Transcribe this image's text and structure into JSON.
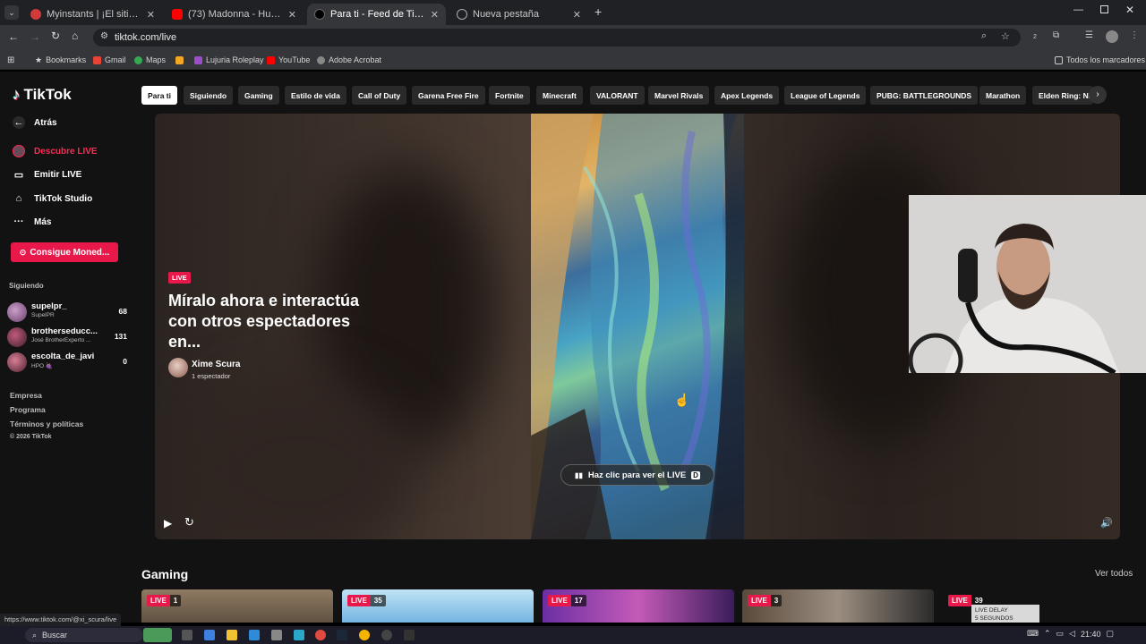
{
  "browser": {
    "tabs": [
      {
        "title": "Myinstants | ¡El sitio web de bo",
        "active": false,
        "color": "#d23b3b"
      },
      {
        "title": "(73) Madonna - Hung Up (Offici",
        "active": false,
        "color": "#ff0000"
      },
      {
        "title": "Para ti - Feed de TikTok LIVE",
        "active": true,
        "color": "#111111"
      },
      {
        "title": "Nueva pestaña",
        "active": false,
        "color": "#8a8a8a"
      }
    ],
    "url": "tiktok.com/live",
    "bookmarks": [
      "Bookmarks",
      "Gmail",
      "Maps",
      "",
      "Lujuria Roleplay",
      "YouTube",
      "Adobe Acrobat"
    ],
    "all_bookmarks": "Todos los marcadores",
    "extensions_badge": "2"
  },
  "sidebar": {
    "logo": "TikTok",
    "back": "Atrás",
    "nav": [
      "Descubre LIVE",
      "Emitir LIVE",
      "TikTok Studio",
      "Más"
    ],
    "coins_button": "Consigue Moned...",
    "following_title": "Siguiendo",
    "following": [
      {
        "name": "supelpr_",
        "sub": "SupelPR",
        "count": "68"
      },
      {
        "name": "brotherseducc...",
        "sub": "José BrotherExperto ...",
        "count": "131"
      },
      {
        "name": "escolta_de_javi",
        "sub": "HPO 🍇",
        "count": "0"
      }
    ],
    "footer": [
      "Empresa",
      "Programa",
      "Términos y políticas",
      "© 2026 TikTok"
    ]
  },
  "categories": [
    "Para ti",
    "Siguiendo",
    "Gaming",
    "Estilo de vida",
    "Call of Duty",
    "Garena Free Fire",
    "Fortnite",
    "Minecraft",
    "VALORANT",
    "Marvel Rivals",
    "Apex Legends",
    "League of Legends",
    "PUBG: BATTLEGROUNDS",
    "Marathon",
    "Elden Ring: Ni"
  ],
  "player": {
    "live_badge": "LIVE",
    "title": "Míralo ahora e interactúa con otros espectadores en...",
    "host_name": "Xime Scura",
    "viewers": "1 espectador",
    "cta": "Haz clic para ver el LIVE",
    "cta_key": "D"
  },
  "gaming": {
    "title": "Gaming",
    "see_all": "Ver todos",
    "cards": [
      {
        "live": "LIVE",
        "viewers": "1"
      },
      {
        "live": "LIVE",
        "viewers": "35"
      },
      {
        "live": "LIVE",
        "viewers": "17"
      },
      {
        "live": "LIVE",
        "viewers": "3"
      },
      {
        "live": "LIVE",
        "viewers": "39"
      }
    ],
    "card_overlay_text": "LIVE DELAY",
    "card_overlay_text2": "5 SEGUNDOS"
  },
  "status_url": "https://www.tiktok.com/@xi_scura/live",
  "taskbar": {
    "search": "Buscar",
    "time": "21:40"
  }
}
